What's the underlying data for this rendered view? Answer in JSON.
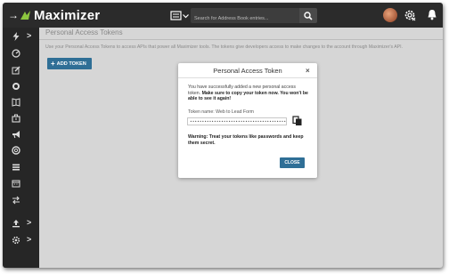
{
  "header": {
    "logo_text": "Maximizer",
    "search_placeholder": "Search for Address Book entries..."
  },
  "sidebar": {
    "items": [
      {
        "icon": "lightning-icon",
        "has_submenu": true
      },
      {
        "icon": "dashboard-gauge-icon",
        "has_submenu": false
      },
      {
        "icon": "edit-icon",
        "has_submenu": false
      },
      {
        "icon": "target-icon",
        "has_submenu": false
      },
      {
        "icon": "address-book-icon",
        "has_submenu": false
      },
      {
        "icon": "briefcase-icon",
        "has_submenu": false
      },
      {
        "icon": "megaphone-icon",
        "has_submenu": false
      },
      {
        "icon": "support-lifebuoy-icon",
        "has_submenu": false
      },
      {
        "icon": "list-icon",
        "has_submenu": false
      },
      {
        "icon": "calendar-icon",
        "has_submenu": false
      },
      {
        "icon": "transfer-arrows-icon",
        "has_submenu": false
      },
      {
        "icon": "upload-icon",
        "has_submenu": true
      },
      {
        "icon": "settings-gear-icon",
        "has_submenu": true
      }
    ]
  },
  "page": {
    "title": "Personal Access Tokens",
    "description": "Use your Personal Access Tokens to access APIs that power all Maximizer tools. The tokens give developers access to make changes to the account through Maximizer's API.",
    "add_button_label": "ADD TOKEN"
  },
  "modal": {
    "title": "Personal Access Token",
    "close_symbol": "×",
    "message_plain": "You have successfully added a new personal access token.",
    "message_bold": "Make sure to copy your token now. You won't be able to see it again!",
    "token_name_label": "Token name: Web to Lead Form",
    "token_value": "••••••••••••••••••••••••••••••••••••••••••••••••••••",
    "warning": "Warning: Treat your tokens like passwords and keep them secret.",
    "close_button_label": "CLOSE"
  },
  "colors": {
    "accent": "#2f6f96",
    "brand_green": "#8dc63f",
    "sidebar_bg": "#262626",
    "topbar_bg": "#2b2b2b",
    "overlay_bg": "#d6d6d6"
  }
}
